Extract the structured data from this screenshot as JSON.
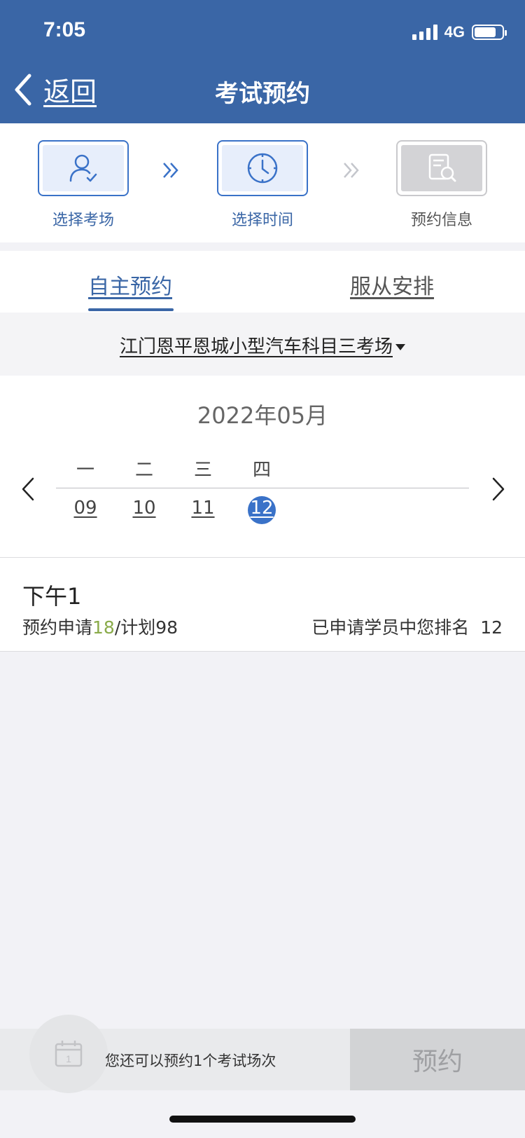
{
  "status_bar": {
    "time": "7:05",
    "network": "4G"
  },
  "header": {
    "back_label": "返回",
    "title": "考试预约"
  },
  "steps": [
    {
      "label": "选择考场",
      "icon": "user-check-icon",
      "state": "done"
    },
    {
      "label": "选择时间",
      "icon": "clock-icon",
      "state": "active"
    },
    {
      "label": "预约信息",
      "icon": "document-search-icon",
      "state": "disabled"
    }
  ],
  "tabs": [
    {
      "label": "自主预约",
      "active": true
    },
    {
      "label": "服从安排",
      "active": false
    }
  ],
  "venue": {
    "name": "江门恩平恩城小型汽车科目三考场"
  },
  "calendar": {
    "month": "2022年05月",
    "weekdays": [
      "一",
      "二",
      "三",
      "四"
    ],
    "dates": [
      "09",
      "10",
      "11",
      "12"
    ],
    "selected": "12"
  },
  "session": {
    "name": "下午1",
    "apply_label": "预约申请",
    "applied": "18",
    "plan_label": "/计划98",
    "rank_label": "已申请学员中您排名",
    "rank": "12"
  },
  "footer": {
    "calendar_day": "1",
    "remaining_text": "您还可以预约1个考试场次",
    "reserve_label": "预约"
  },
  "colors": {
    "primary": "#3a66a6",
    "accent": "#3a72c8",
    "applied": "#8aab4a"
  }
}
